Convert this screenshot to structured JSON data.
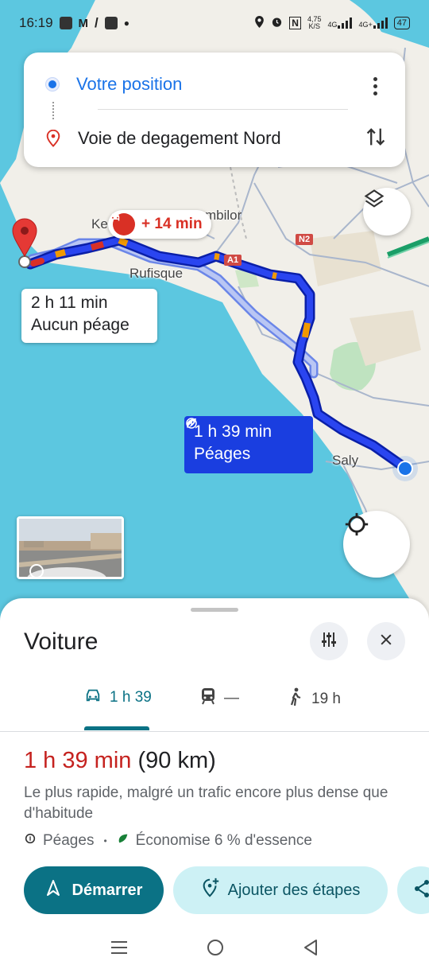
{
  "status_bar": {
    "time": "16:19",
    "net_speed": "4,75\nK/S",
    "net_speed_value": "4,75",
    "net_speed_unit": "K/S",
    "net1": "4G",
    "net2": "4G+",
    "battery": "47"
  },
  "search": {
    "origin": "Votre position",
    "destination": "Voie de degagement Nord"
  },
  "map": {
    "labels": {
      "ke": "Ke",
      "mbilor": "mbilor",
      "rufisque": "Rufisque",
      "saly": "Saly",
      "n2": "N2",
      "a1": "A1"
    },
    "traffic_delay": "+ 14 min",
    "alt_route": {
      "duration": "2 h 11 min",
      "note": "Aucun péage"
    },
    "main_route": {
      "duration": "1 h 39 min",
      "note": "Péages"
    },
    "colors": {
      "water": "#5cc7e0",
      "route_main": "#1a3ee0",
      "route_alt": "#a8b8f2",
      "traffic_red": "#d93025",
      "traffic_orange": "#f29900"
    }
  },
  "sheet": {
    "title": "Voiture",
    "tabs": [
      {
        "label": "1 h 39",
        "icon": "car-icon"
      },
      {
        "label": "—",
        "icon": "train-icon"
      },
      {
        "label": "19 h",
        "icon": "walk-icon"
      }
    ],
    "route_duration": "1 h 39 min",
    "route_distance": "(90 km)",
    "route_description": "Le plus rapide, malgré un trafic encore plus dense que d'habitude",
    "meta_tolls": "Péages",
    "meta_sep": "•",
    "meta_eco": "Économise 6 % d'essence",
    "start_label": "Démarrer",
    "stops_label": "Ajouter des étapes"
  }
}
